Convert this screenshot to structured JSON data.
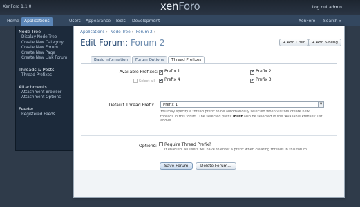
{
  "app": {
    "version": "XenForo 1.1.0",
    "logo_main": "xen",
    "logo_rest": "Foro",
    "logout": "Log out admin"
  },
  "nav": {
    "tabs": [
      "Home",
      "Applications",
      "Users",
      "Appearance",
      "Tools",
      "Development"
    ],
    "active_tab": "Applications",
    "right_link": "XenForo",
    "search": "Search"
  },
  "sidebar": {
    "groups": [
      {
        "heading": "Node Tree",
        "items": [
          "Display Node Tree",
          "Create New Category",
          "Create New Forum",
          "Create New Page",
          "Create New Link Forum"
        ]
      },
      {
        "heading": "Threads & Posts",
        "items": [
          "Thread Prefixes"
        ]
      },
      {
        "heading": "Attachments",
        "items": [
          "Attachment Browser",
          "Attachment Options"
        ]
      },
      {
        "heading": "Feeder",
        "items": [
          "Registered Feeds"
        ]
      }
    ]
  },
  "page": {
    "breadcrumb": [
      "Applications",
      "Node Tree",
      "Forum 2"
    ],
    "title_prefix": "Edit Forum:",
    "title_name": "Forum 2",
    "add_child": "+ Add Child",
    "add_sibling": "+ Add Sibling",
    "tabs": [
      "Basic Information",
      "Forum Options",
      "Thread Prefixes"
    ],
    "active_tab": "Thread Prefixes"
  },
  "form": {
    "available_label": "Available Prefixes:",
    "select_all": "Select all",
    "prefixes": [
      {
        "label": "Prefix 1",
        "checked": true
      },
      {
        "label": "Prefix 2",
        "checked": true
      },
      {
        "label": "Prefix 4",
        "checked": true
      },
      {
        "label": "Prefix 3",
        "checked": true
      }
    ],
    "default_label": "Default Thread Prefix",
    "default_value": "Prefix 1",
    "default_hint_1": "You may specify a thread prefix to be automatically selected when visitors create new",
    "default_hint_2": "threads in this forum. The selected prefix",
    "default_hint_bold": "must",
    "default_hint_3": "also be selected in the 'Available Prefixes' list",
    "default_hint_4": "above.",
    "options_label": "Options:",
    "require_label": "Require Thread Prefix?",
    "require_checked": false,
    "require_hint": "If enabled, all users will have to enter a prefix when creating threads in this forum."
  },
  "actions": {
    "save": "Save Forum",
    "delete": "Delete Forum..."
  }
}
